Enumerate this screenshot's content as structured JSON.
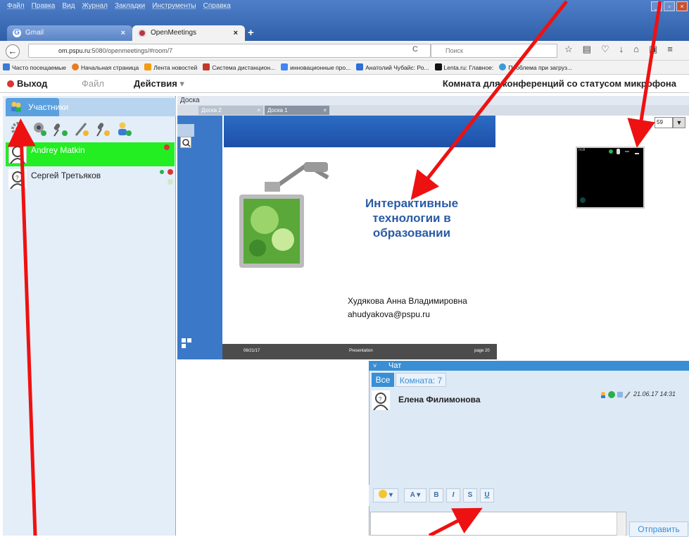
{
  "browser": {
    "menu": [
      "Файл",
      "Правка",
      "Вид",
      "Журнал",
      "Закладки",
      "Инструменты",
      "Справка"
    ],
    "tabs": [
      {
        "label": "Gmail"
      },
      {
        "label": "OpenMeetings"
      }
    ],
    "url_host": "om.pspu.ru",
    "url_rest": ":5080/openmeetings/#room/7",
    "search_placeholder": "Поиск",
    "bookmarks": [
      "Часто посещаемые",
      "Начальная страница",
      "Лента новостей",
      "Система дистанцион...",
      "инновационные про...",
      "Анатолий Чубайс: Ро...",
      "Lenta.ru: Главное:",
      "Проблема при загруз..."
    ]
  },
  "app": {
    "exit_label": "Выход",
    "file_label": "Файл",
    "actions_label": "Действия",
    "room_title": "Комната для конференций со статусом микрофона"
  },
  "participants": {
    "tab_label": "Участники",
    "users": [
      {
        "name": "Andrey Matkin"
      },
      {
        "name": "Сергей Третьяков"
      }
    ]
  },
  "whiteboard": {
    "header": "Доска",
    "tabs": [
      "Доска 2",
      "Доска 1"
    ],
    "page": "59",
    "slide": {
      "title_lines": [
        "Интерактивные",
        "технологии в",
        "образовании"
      ],
      "author": "Худякова Анна Владимировна",
      "email": "ahudyakova@pspu.ru",
      "footer_date": "06/21/17",
      "footer_center": "Presentation",
      "footer_page": "page 20"
    },
    "video_label": "null"
  },
  "chat": {
    "header": "Чат",
    "tabs": [
      "Все",
      "Комната: 7"
    ],
    "message": {
      "author": "Елена Филимонова",
      "time": "21.06.17 14:31"
    },
    "format_buttons": [
      "A",
      "B",
      "I",
      "S",
      "U"
    ],
    "send_label": "Отправить"
  },
  "colors": {
    "accent": "#3a8fd4",
    "active_user": "#22ee22",
    "arrow": "#ee1111"
  }
}
